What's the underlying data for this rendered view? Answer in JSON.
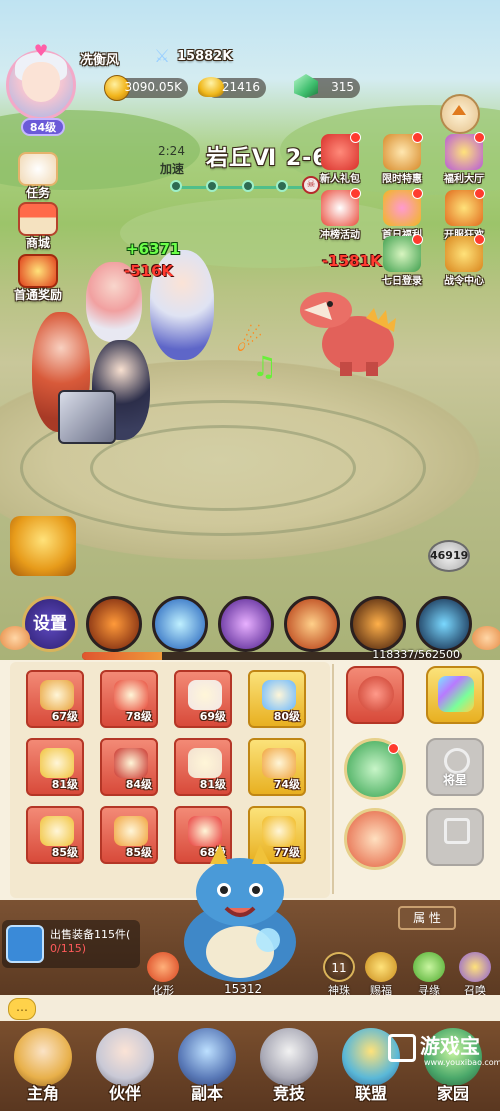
{
  "player": {
    "name": "冼衡风",
    "level": "84级",
    "power": "15882K"
  },
  "currencies": [
    {
      "icon": "gold-coin-icon",
      "value": "3090.05K"
    },
    {
      "icon": "gold-ingot-icon",
      "value": "21416"
    },
    {
      "icon": "jade-icon",
      "value": "315"
    }
  ],
  "battle": {
    "timer": "2:24",
    "speed_label": "加速",
    "stage": "岩丘Ⅵ 2-6",
    "floating": {
      "heal": "+6371",
      "damage_hero": "-516K",
      "damage_enemy": "-1581K"
    }
  },
  "left_menu": [
    {
      "label": "任务",
      "icon": "task-icon"
    },
    {
      "label": "商城",
      "icon": "shop-icon"
    },
    {
      "label": "首通奖励",
      "icon": "first-clear-reward-icon"
    }
  ],
  "events": [
    {
      "label": "新人礼包",
      "icon": "gift-icon"
    },
    {
      "label": "限时特惠",
      "icon": "hourglass-icon"
    },
    {
      "label": "福利大厅",
      "icon": "treasure-chest-icon"
    },
    {
      "label": "冲榜活动",
      "icon": "ranking-icon"
    },
    {
      "label": "首日福利",
      "icon": "gift-box-icon"
    },
    {
      "label": "开服狂欢",
      "icon": "carnival-icon"
    },
    {
      "label": "七日登录",
      "icon": "calendar-icon"
    },
    {
      "label": "战令中心",
      "icon": "battle-pass-icon"
    }
  ],
  "spirit_count": "46919",
  "skill_bar": {
    "settings_label": "设置",
    "hp_text": "118337/562500",
    "hp_fraction": 0.21
  },
  "equipment": [
    {
      "icon": "bow-icon",
      "level": "67级",
      "color": "red"
    },
    {
      "icon": "armor-icon",
      "level": "78级",
      "color": "red"
    },
    {
      "icon": "boots-icon",
      "level": "69级",
      "color": "red"
    },
    {
      "icon": "shield-emblem-icon",
      "level": "80级",
      "color": "gold"
    },
    {
      "icon": "amulet-icon",
      "level": "81级",
      "color": "red"
    },
    {
      "icon": "gauntlet-icon",
      "level": "84级",
      "color": "red"
    },
    {
      "icon": "robe-icon",
      "level": "81级",
      "color": "red"
    },
    {
      "icon": "belt-icon",
      "level": "74级",
      "color": "gold"
    },
    {
      "icon": "ring-icon",
      "level": "85级",
      "color": "red"
    },
    {
      "icon": "bracelet-icon",
      "level": "85级",
      "color": "red"
    },
    {
      "icon": "shoes-icon",
      "level": "68级",
      "color": "red"
    },
    {
      "icon": "golden-armor-icon",
      "level": "77级",
      "color": "gold"
    }
  ],
  "side_panel": {
    "general_label": "将星",
    "locked_icon": "sword-emblem-icon"
  },
  "bottom": {
    "sell_text": "出售装备115件(",
    "sell_count": "0/115)",
    "attr_label": "属 性",
    "dragon_count": "15312",
    "morph_label": "化形",
    "actions": [
      {
        "label": "神珠",
        "badge": "11",
        "icon": "orb-icon"
      },
      {
        "label": "赐福",
        "icon": "blessing-icon"
      },
      {
        "label": "寻缘",
        "icon": "leaf-icon"
      },
      {
        "label": "召唤",
        "icon": "summon-icon"
      }
    ]
  },
  "nav": [
    {
      "label": "主角",
      "icon": "hero-portrait-icon"
    },
    {
      "label": "伙伴",
      "icon": "partner-portrait-icon"
    },
    {
      "label": "副本",
      "icon": "dungeon-icon"
    },
    {
      "label": "竞技",
      "icon": "crossed-swords-icon"
    },
    {
      "label": "联盟",
      "icon": "alliance-icon"
    },
    {
      "label": "家园",
      "icon": "home-icon"
    }
  ],
  "watermark": {
    "text": "游戏宝",
    "url": "www.youxibao.com"
  }
}
